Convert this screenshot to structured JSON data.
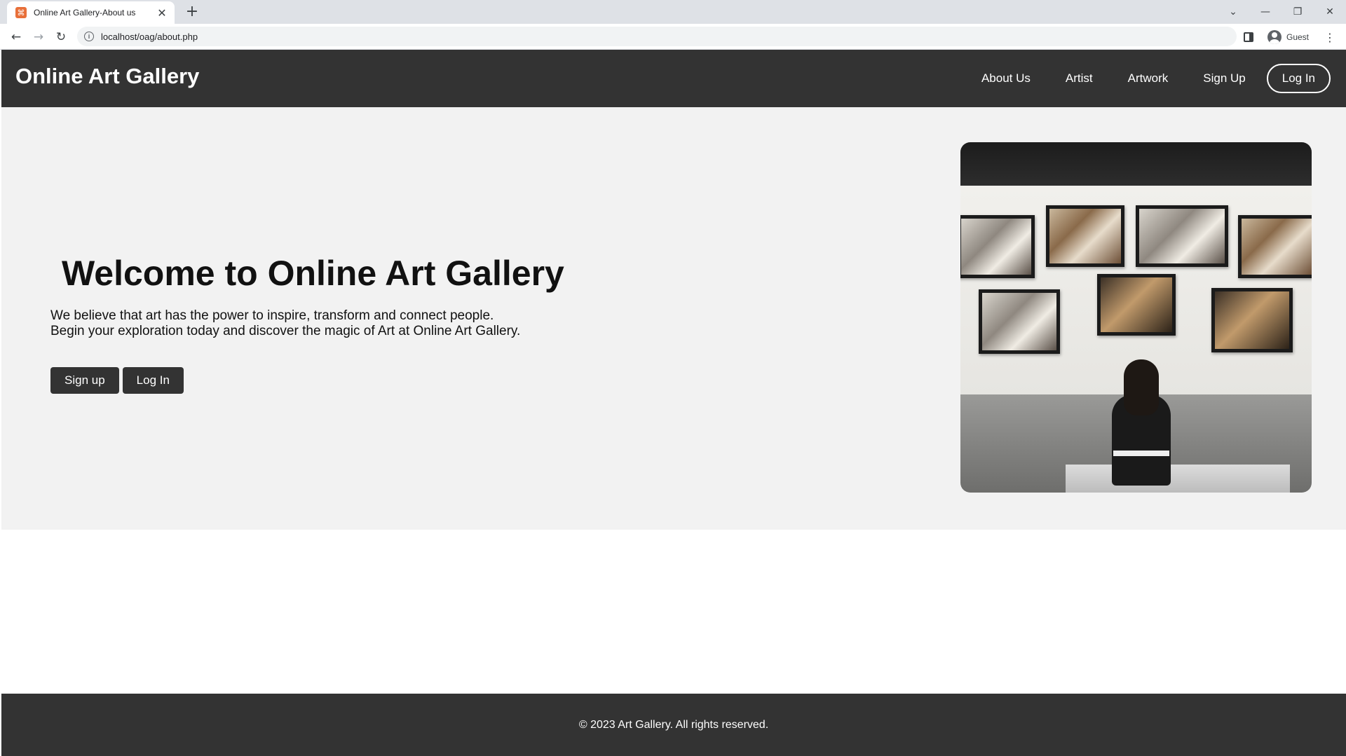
{
  "browser": {
    "tab": {
      "title": "Online Art Gallery-About us",
      "close_glyph": "✕"
    },
    "new_tab_glyph": "+",
    "window_controls": {
      "tab_search": "⌄",
      "minimize": "—",
      "restore": "❐",
      "close": "✕"
    },
    "nav": {
      "back": "←",
      "forward": "→",
      "reload": "↻"
    },
    "address": {
      "info_glyph": "i",
      "url": "localhost/oag/about.php"
    },
    "profile": {
      "name": "Guest"
    },
    "menu_glyph": "⋮"
  },
  "site": {
    "brand": "Online Art Gallery",
    "nav": {
      "about": "About Us",
      "artist": "Artist",
      "artwork": "Artwork",
      "signup": "Sign Up",
      "login": "Log In"
    }
  },
  "hero": {
    "title": "Welcome to Online Art Gallery",
    "line1": "We believe that art has the power to inspire, transform and connect people.",
    "line2": "Begin your exploration today and discover the magic of Art at Online Art Gallery.",
    "signup_button": "Sign up",
    "login_button": "Log In"
  },
  "footer": {
    "text": "© 2023 Art Gallery. All rights reserved."
  },
  "colors": {
    "header_bg": "#333333",
    "hero_bg": "#f2f2f2",
    "button_bg": "#333333",
    "tabstrip_bg": "#dee1e6"
  }
}
